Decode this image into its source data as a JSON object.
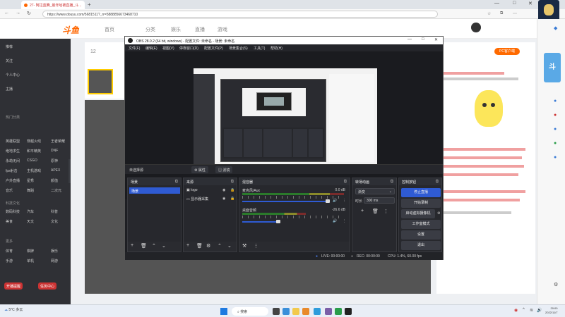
{
  "browser": {
    "tab_title": "27- 阿拉蓝腾_最年哈被直播_斗...",
    "url": "https://www.douyu.com/5681511?_rr=5888856673468710",
    "new_tab": "+",
    "win_min": "—",
    "win_max": "□",
    "win_close": "✕"
  },
  "site": {
    "logo": "斗鱼",
    "nav": [
      "首页",
      "分类",
      "娱乐",
      "直播",
      "游戏"
    ],
    "fan_count": "12",
    "pc_button": "PC客户端"
  },
  "sidebar": {
    "items": [
      {
        "label": "推荐"
      },
      {
        "label": "关注"
      },
      {
        "label": "个人中心"
      },
      {
        "label": "主播"
      }
    ],
    "section_head": "热门分类",
    "grid": [
      [
        "英雄联盟",
        "穿越火线",
        "王者荣耀"
      ],
      [
        "绝地求生",
        "和平精英",
        "DNF"
      ],
      [
        "永劫无间",
        "CSGO",
        "原神"
      ],
      [
        "fps射击",
        "主机游戏",
        "APEX"
      ],
      [
        "户外直播",
        "星秀",
        "颜值"
      ],
      [
        "音乐",
        "舞蹈",
        "二次元"
      ]
    ],
    "section_head_2": "科技文化",
    "grid2": [
      [
        "数码科技",
        "汽车",
        "科普"
      ],
      [
        "美食",
        "天文",
        "文化"
      ]
    ],
    "section_head_3": "更多",
    "grid3": [
      [
        "体育",
        "棋牌",
        "娱乐"
      ],
      [
        "手游",
        "单机",
        "网游"
      ]
    ],
    "badge_left": "开播提醒",
    "badge_right": "任务中心"
  },
  "obs": {
    "title": "OBS 28.0.2 (64 bit, windows) - 配置文件: 未命名 - 场景: 未命名",
    "menu": [
      "文件(F)",
      "编辑(E)",
      "视图(V)",
      "停靠窗口(D)",
      "配置文件(P)",
      "场景集合(S)",
      "工具(T)",
      "帮助(H)"
    ],
    "scene_bar": {
      "name": "未选择源",
      "properties": "属性",
      "filters": "滤镜"
    },
    "docks": {
      "scenes": {
        "title": "场景",
        "items": [
          "场景"
        ]
      },
      "sources": {
        "title": "来源",
        "items": [
          "logo",
          "显示器采集"
        ]
      },
      "mixer": {
        "title": "混音器",
        "channels": [
          {
            "name": "麦克风/Aux",
            "db": "0.0 dB"
          },
          {
            "name": "桌面音频",
            "db": "-26.6 dB"
          }
        ]
      },
      "transitions": {
        "title": "转场动画",
        "selected": "渐变",
        "duration_label": "时长",
        "duration": "300 ms"
      },
      "controls": {
        "title": "控制按钮",
        "buttons": [
          "停止直播",
          "开始录制",
          "启动虚拟摄像机",
          "工作室模式",
          "设置",
          "退出"
        ]
      }
    },
    "status": {
      "live": "LIVE: 00:00:00",
      "rec": "REC: 00:00:00",
      "cpu": "CPU: 1.4%, 60.00 fps"
    }
  },
  "taskbar": {
    "weather_temp": "5°C",
    "weather_desc": "多云",
    "search": "搜索",
    "time": "20:00",
    "date": "2022/11/7"
  },
  "colors": {
    "brand": "#ff6a00",
    "obs_accent": "#2f5bd3"
  }
}
